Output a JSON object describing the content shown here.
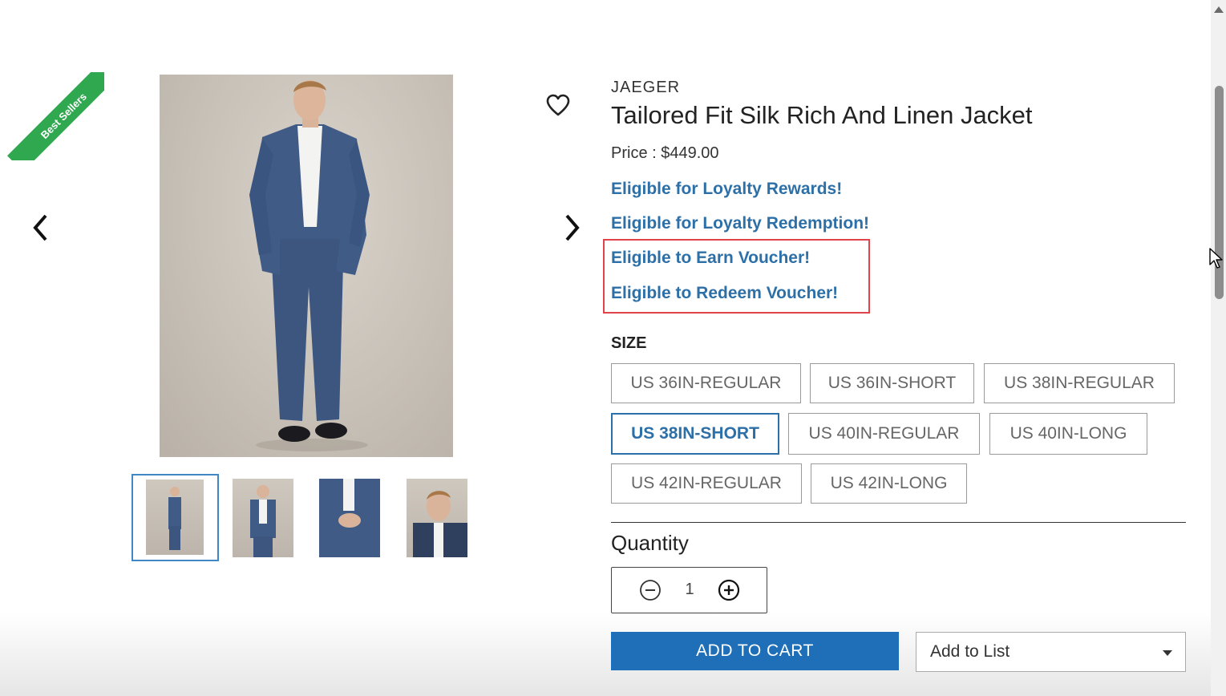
{
  "badge": {
    "text": "Best Sellers",
    "color": "#2fa84f"
  },
  "gallery": {
    "prev_icon": "chevron-left-icon",
    "next_icon": "chevron-right-icon",
    "wishlist_icon": "heart-outline-icon",
    "thumbnails": [
      "full-length-front",
      "three-quarter-front",
      "hands-detail",
      "portrait-side"
    ],
    "selected_thumbnail": 0
  },
  "product": {
    "brand": "JAEGER",
    "title": "Tailored Fit Silk Rich And Linen Jacket",
    "price": "Price : $449.00",
    "eligibility": [
      "Eligible for Loyalty Rewards!",
      "Eligible for Loyalty Redemption!",
      "Eligible to Earn Voucher!",
      "Eligible to Redeem Voucher!"
    ],
    "link_color": "#2d6fa7",
    "highlight_color": "#e0434a"
  },
  "size": {
    "label": "SIZE",
    "options": [
      "US 36IN-REGULAR",
      "US 36IN-SHORT",
      "US 38IN-REGULAR",
      "US 38IN-SHORT",
      "US 40IN-REGULAR",
      "US 40IN-LONG",
      "US 42IN-REGULAR",
      "US 42IN-LONG"
    ],
    "selected": "US 38IN-SHORT"
  },
  "quantity": {
    "label": "Quantity",
    "value": "1",
    "minus_icon": "minus-circle-icon",
    "plus_icon": "plus-circle-icon"
  },
  "actions": {
    "add_to_cart": "ADD TO CART",
    "add_to_list": "Add to List",
    "cart_color": "#1e6fb8"
  }
}
